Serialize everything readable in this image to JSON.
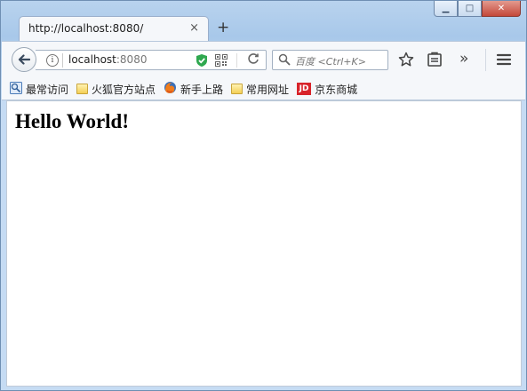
{
  "window": {
    "caption": {
      "minimize": "▁",
      "maximize": "□",
      "close": "✕"
    }
  },
  "tabs": [
    {
      "title": "http://localhost:8080/",
      "close": "×"
    }
  ],
  "new_tab": "+",
  "toolbar": {
    "url": {
      "host": "localhost",
      "port": ":8080"
    },
    "search": {
      "placeholder": "百度 <Ctrl+K>"
    },
    "overflow": "»"
  },
  "bookmarks": [
    {
      "label": "最常访问",
      "icon": "most-visited-icon"
    },
    {
      "label": "火狐官方站点",
      "icon": "folder-icon"
    },
    {
      "label": "新手上路",
      "icon": "firefox-icon"
    },
    {
      "label": "常用网址",
      "icon": "folder-icon"
    },
    {
      "label": "京东商城",
      "icon": "jd-icon",
      "icon_text": "JD"
    }
  ],
  "page": {
    "heading": "Hello World!"
  },
  "colors": {
    "frame": "#a8c8ea",
    "toolbar": "#f5f7fa",
    "close_button": "#c4483a",
    "jd_brand": "#d8232a",
    "shield_green": "#2fa84f"
  }
}
